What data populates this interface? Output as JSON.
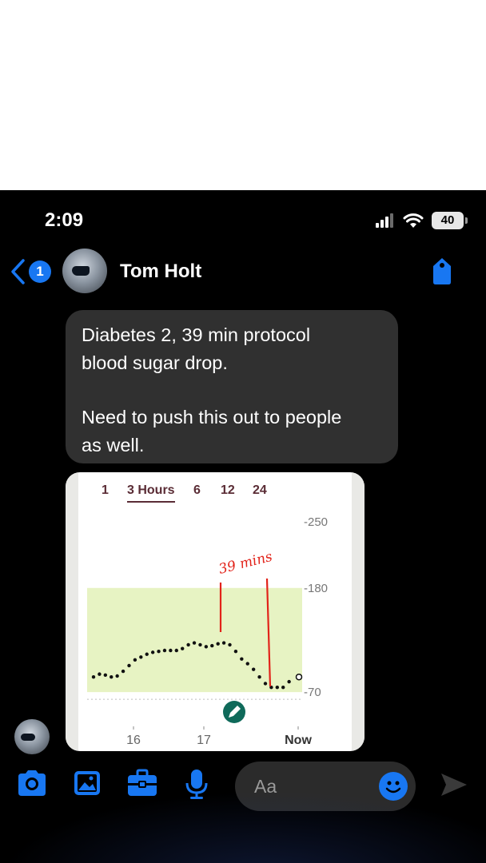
{
  "status_bar": {
    "time": "2:09",
    "battery": "40"
  },
  "header": {
    "back_count": "1",
    "contact_name": "Tom Holt"
  },
  "message": {
    "line1": "Diabetes 2, 39 min protocol",
    "line2": "blood sugar drop.",
    "line3": "Need to push this out to people",
    "line4": "as well."
  },
  "image": {
    "tabs": [
      "1",
      "3 Hours",
      "6",
      "12",
      "24"
    ],
    "active_tab": "3 Hours",
    "annotation": "39 mins",
    "chart_data": {
      "type": "scatter",
      "x_ticks": [
        "16",
        "17",
        "Now"
      ],
      "y_ticks": [
        250,
        180,
        70
      ],
      "target_range": [
        70,
        180
      ],
      "ylim": [
        60,
        260
      ],
      "points": [
        [
          0.0,
          86
        ],
        [
          0.03,
          89
        ],
        [
          0.06,
          88
        ],
        [
          0.09,
          86
        ],
        [
          0.12,
          87
        ],
        [
          0.15,
          92
        ],
        [
          0.18,
          98
        ],
        [
          0.21,
          104
        ],
        [
          0.24,
          107
        ],
        [
          0.27,
          110
        ],
        [
          0.3,
          112
        ],
        [
          0.33,
          113
        ],
        [
          0.36,
          114
        ],
        [
          0.39,
          114
        ],
        [
          0.42,
          114
        ],
        [
          0.45,
          116
        ],
        [
          0.48,
          120
        ],
        [
          0.51,
          122
        ],
        [
          0.54,
          120
        ],
        [
          0.57,
          118
        ],
        [
          0.6,
          119
        ],
        [
          0.63,
          121
        ],
        [
          0.66,
          122
        ],
        [
          0.69,
          120
        ],
        [
          0.72,
          113
        ],
        [
          0.75,
          105
        ],
        [
          0.78,
          100
        ],
        [
          0.81,
          94
        ],
        [
          0.84,
          86
        ],
        [
          0.87,
          79
        ],
        [
          0.9,
          75
        ],
        [
          0.93,
          75
        ],
        [
          0.96,
          75
        ],
        [
          0.99,
          81
        ]
      ],
      "current_point": [
        1.04,
        86
      ]
    }
  },
  "composer": {
    "placeholder": "Aa"
  }
}
